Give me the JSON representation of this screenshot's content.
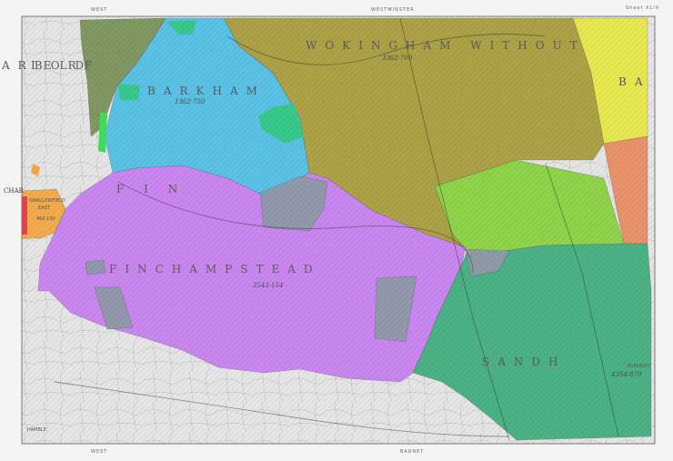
{
  "map": {
    "sheet_label": "Sheet XLIV",
    "margin_top_left": "WEST",
    "margin_top_center": "WESTMINSTER",
    "margin_bottom_left": "WEST",
    "margin_bottom_center": "BARNET",
    "colors": {
      "base": "#e6e6e6",
      "finchampstead": "#c77cf0",
      "barkham": "#4fbfe6",
      "wokingham_without": "#a69a36",
      "sandhurst": "#3fae7e",
      "lime_area": "#86d23a",
      "north_east": "#e8e84a",
      "east_edge": "#e98a5e",
      "arborfield": "#6f8a4a",
      "swallowfield": "#f2a844",
      "grey_patch": "#8f9aa8"
    },
    "labels": {
      "arborfield": "ARBORF",
      "arborfield_tail": "IELD",
      "barkham": "BARKHAM",
      "barkham_area": "1362·750",
      "wokingham": "WOKINGHAM WITHOUT",
      "wokingham_area": "3362·700",
      "finchampstead_top": "F I N",
      "finchampstead": "FINCHAMPSTEAD",
      "finchampstead_area": "3543·154",
      "sandhurst": "SANDH",
      "sandhurst_area": "4354·870",
      "swallowfield": "SWALLOWFIELD",
      "swallowfield_sub": "EAST",
      "swallowfield_area": "460·190",
      "charl": "CHAR",
      "ba": "BA",
      "eversley": "EVERSLEY",
      "hamble": "HAMBLE"
    }
  }
}
